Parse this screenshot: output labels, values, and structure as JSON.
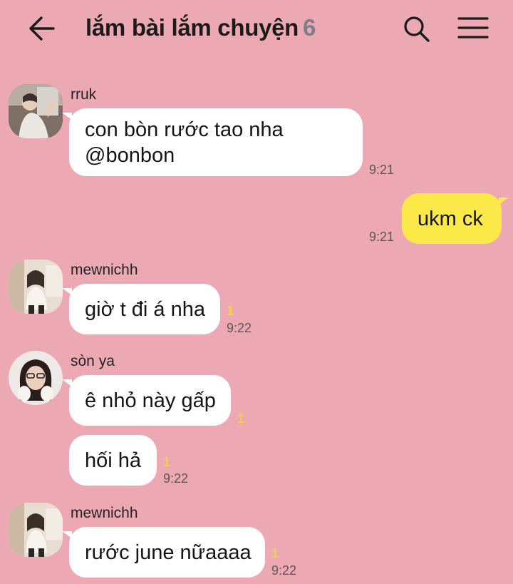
{
  "header": {
    "title": "lắm bài lắm chuyện",
    "member_count": "6"
  },
  "messages": [
    {
      "sender": "rruk",
      "line1": "con bòn rước tao nha",
      "line2": "@bonbon",
      "time": "9:21"
    },
    {
      "text": "ukm ck",
      "time": "9:21"
    },
    {
      "sender": "mewnichh",
      "text": "giờ t đi á nha",
      "unread": "1",
      "time": "9:22"
    },
    {
      "sender": "sòn ya",
      "text": "ê nhỏ này gấp",
      "unread": "1"
    },
    {
      "text": "hối hả",
      "unread": "1",
      "time": "9:22"
    },
    {
      "sender": "mewnichh",
      "text": "rước june nữaaaa",
      "unread": "1",
      "time": "9:22"
    }
  ],
  "icons": {
    "back": "arrow-left-icon",
    "search": "search-icon",
    "menu": "hamburger-menu-icon"
  },
  "colors": {
    "background": "#eca9b3",
    "bubble_incoming": "#ffffff",
    "bubble_outgoing": "#fbe94a",
    "unread": "#f5d23a"
  }
}
